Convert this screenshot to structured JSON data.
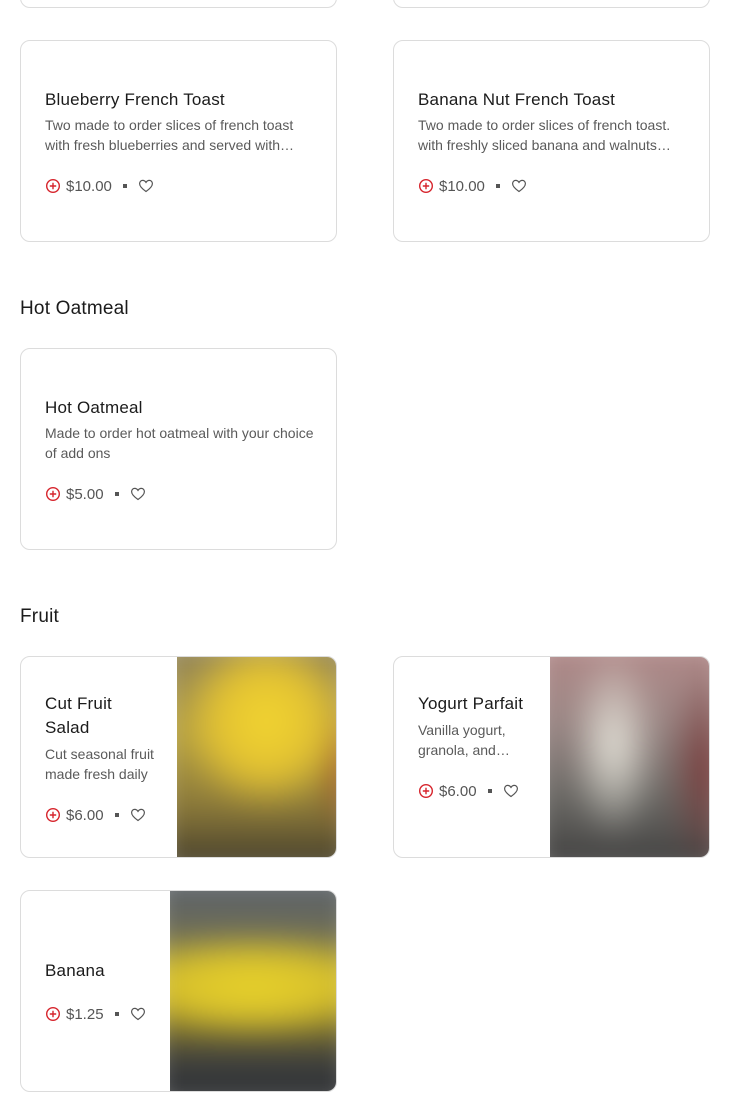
{
  "menu": {
    "sections": [
      {
        "title": "",
        "items": [
          {
            "name": "Blueberry French Toast",
            "description": "Two made to order slices of french toast with fresh blueberries and served with maple syrup",
            "price": "$10.00"
          },
          {
            "name": "Banana Nut French Toast",
            "description": "Two made to order slices of french toast. with freshly sliced banana and walnuts served with maple syrup",
            "price": "$10.00"
          }
        ]
      },
      {
        "title": "Hot Oatmeal",
        "items": [
          {
            "name": "Hot Oatmeal",
            "description": "Made to order hot oatmeal with your choice of add ons",
            "price": "$5.00"
          }
        ]
      },
      {
        "title": "Fruit",
        "items": [
          {
            "name": "Cut Fruit Salad",
            "description": "Cut seasonal fruit made fresh daily",
            "price": "$6.00",
            "image": "fruit-salad-photo"
          },
          {
            "name": "Yogurt Parfait",
            "description": "Vanilla yogurt, granola, and fresh berries",
            "price": "$6.00",
            "image": "yogurt-parfait-photo"
          },
          {
            "name": "Banana",
            "description": "",
            "price": "$1.25",
            "image": "banana-photo"
          }
        ]
      }
    ]
  },
  "icons": {
    "add": "add-circle-icon",
    "favorite": "heart-outline-icon"
  },
  "colors": {
    "accent": "#d6242c",
    "border": "#dcdcdc",
    "text": "#1b1b1b",
    "muted": "#5a5a5a"
  }
}
